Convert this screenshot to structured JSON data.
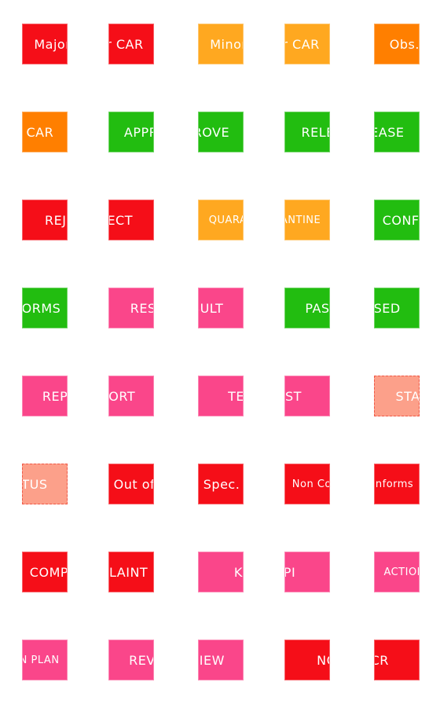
{
  "colors": {
    "red": "#f50e18",
    "amber": "#ffa820",
    "orange": "#ff7f00",
    "green": "#22bd10",
    "pink": "#fa468a",
    "salmon": "#fca08a"
  },
  "labels": [
    {
      "text": "Major CAR",
      "color": "#f50e18"
    },
    {
      "text": "Minor CAR",
      "color": "#ffa820"
    },
    {
      "text": "Obs. CAR",
      "color": "#ff7f00"
    },
    {
      "text": "APPROVE",
      "color": "#22bd10"
    },
    {
      "text": "RELEASE",
      "color": "#22bd10"
    },
    {
      "text": "REJECT",
      "color": "#f50e18"
    },
    {
      "text": "QUARANTINE",
      "color": "#ffa820",
      "small": true
    },
    {
      "text": "CONFORMS",
      "color": "#22bd10"
    },
    {
      "text": "RESULT",
      "color": "#fa468a"
    },
    {
      "text": "PASSED",
      "color": "#22bd10"
    },
    {
      "text": "REPORT",
      "color": "#fa468a"
    },
    {
      "text": "TEST",
      "color": "#fa468a"
    },
    {
      "text": "STATUS",
      "color": "#fca08a",
      "dashed": true
    },
    {
      "text": "Out of Spec.",
      "color": "#f50e18"
    },
    {
      "text": "Non Conforms",
      "color": "#f50e18",
      "small": true
    },
    {
      "text": "COMPLAINT",
      "color": "#f50e18"
    },
    {
      "text": "KPI",
      "color": "#fa468a"
    },
    {
      "text": "ACTION PLAN",
      "color": "#fa468a",
      "small": true
    },
    {
      "text": "REVIEW",
      "color": "#fa468a"
    },
    {
      "text": "NCR",
      "color": "#f50e18"
    }
  ]
}
